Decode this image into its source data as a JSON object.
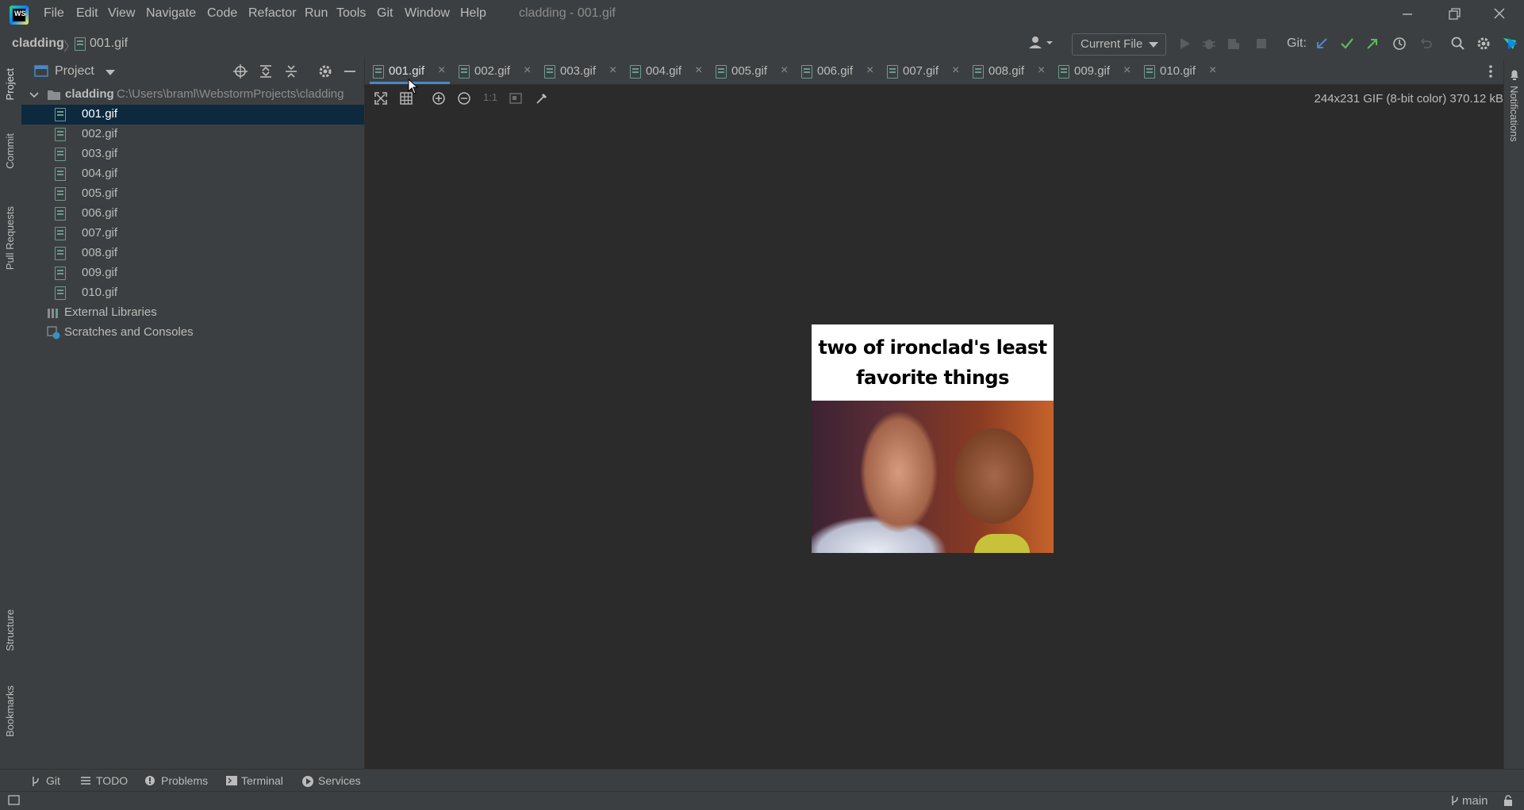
{
  "menu": {
    "items": [
      "File",
      "Edit",
      "View",
      "Navigate",
      "Code",
      "Refactor",
      "Run",
      "Tools",
      "Git",
      "Window",
      "Help"
    ],
    "window_title": "cladding - 001.gif"
  },
  "navbar": {
    "root": "cladding",
    "file": "001.gif",
    "run_config": "Current File",
    "git_label": "Git:"
  },
  "left_strip": {
    "tabs": [
      "Project",
      "Commit",
      "Pull Requests",
      "Structure",
      "Bookmarks"
    ]
  },
  "right_strip": {
    "tabs": [
      "Notifications"
    ]
  },
  "project": {
    "title": "Project",
    "root": {
      "name": "cladding",
      "path": "C:\\Users\\braml\\WebstormProjects\\cladding"
    },
    "files": [
      "001.gif",
      "002.gif",
      "003.gif",
      "004.gif",
      "005.gif",
      "006.gif",
      "007.gif",
      "008.gif",
      "009.gif",
      "010.gif"
    ],
    "selected": "001.gif",
    "external": "External Libraries",
    "scratches": "Scratches and Consoles"
  },
  "tabs": [
    "001.gif",
    "002.gif",
    "003.gif",
    "004.gif",
    "005.gif",
    "006.gif",
    "007.gif",
    "008.gif",
    "009.gif",
    "010.gif"
  ],
  "active_tab": "001.gif",
  "editor": {
    "zoom_label": "1:1",
    "image_info": "244x231 GIF (8-bit color) 370.12 kB",
    "caption": "two of ironclad's least favorite things"
  },
  "bottom_tools": [
    "Git",
    "TODO",
    "Problems",
    "Terminal",
    "Services"
  ],
  "status": {
    "branch": "main"
  },
  "colors": {
    "accent": "#4a88c7",
    "selection": "#0d293e",
    "background": "#2b2b2b",
    "panel": "#3c3f41"
  }
}
